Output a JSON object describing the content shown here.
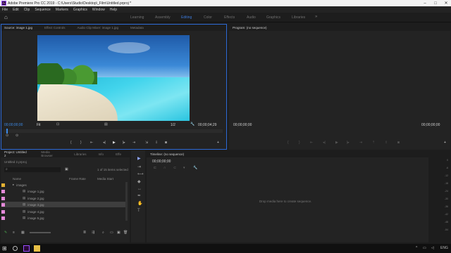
{
  "titlebar": {
    "title": "Adobe Premiere Pro CC 2019 - C:\\Users\\Studio\\Desktop\\_Film\\Untitled.prproj *",
    "minimize": "–",
    "maximize": "□",
    "close": "✕"
  },
  "menu": [
    "File",
    "Edit",
    "Clip",
    "Sequence",
    "Markers",
    "Graphics",
    "Window",
    "Help"
  ],
  "workspaces": [
    "Learning",
    "Assembly",
    "Editing",
    "Color",
    "Effects",
    "Audio",
    "Graphics",
    "Libraries"
  ],
  "active_workspace": "Editing",
  "source_panel": {
    "tabs": [
      "Source: image 1.jpg",
      "Effect Controls",
      "Audio Clip Mixer: image 1.jpg",
      "Metadata"
    ],
    "timecode_in": "00;00;00;00",
    "timecode_out": "00;00;04;29",
    "fit": "Fit",
    "resolution": "1/2",
    "playback_progress": 0.01
  },
  "program_panel": {
    "tab": "Program: (no sequence)",
    "timecode_left": "00;00;00;00",
    "timecode_right": "00;00;00;00"
  },
  "project_panel": {
    "tabs": [
      "Project: Untitled 2",
      "Media Browser",
      "Libraries",
      "Info",
      "Effe"
    ],
    "project_file": "Untitled 2.prproj",
    "items_selected": "1 of 15 items selected",
    "columns": {
      "name": "Name",
      "frame_rate": "Frame Rate",
      "media_start": "Media Start"
    },
    "folder": "images",
    "items": [
      {
        "label": "image 1.jpg",
        "selected": false
      },
      {
        "label": "image 2.jpg",
        "selected": false
      },
      {
        "label": "image 3.jpg",
        "selected": true
      },
      {
        "label": "image 4.jpg",
        "selected": false
      },
      {
        "label": "image 5.jpg",
        "selected": false
      }
    ]
  },
  "timeline": {
    "tab": "Timeline: (no sequence)",
    "timecode": "00;00;00;00",
    "empty_message": "Drop media here to create sequence."
  },
  "meter_labels": [
    "0",
    "-6",
    "-12",
    "-18",
    "-24",
    "-30",
    "-36",
    "-42",
    "-48",
    "-54"
  ],
  "taskbar": {
    "lang": "ENG"
  },
  "colors": {
    "accent": "#2d6ad6",
    "timecode_blue": "#3d8ae6",
    "bin_pink": "#e58ad9"
  }
}
